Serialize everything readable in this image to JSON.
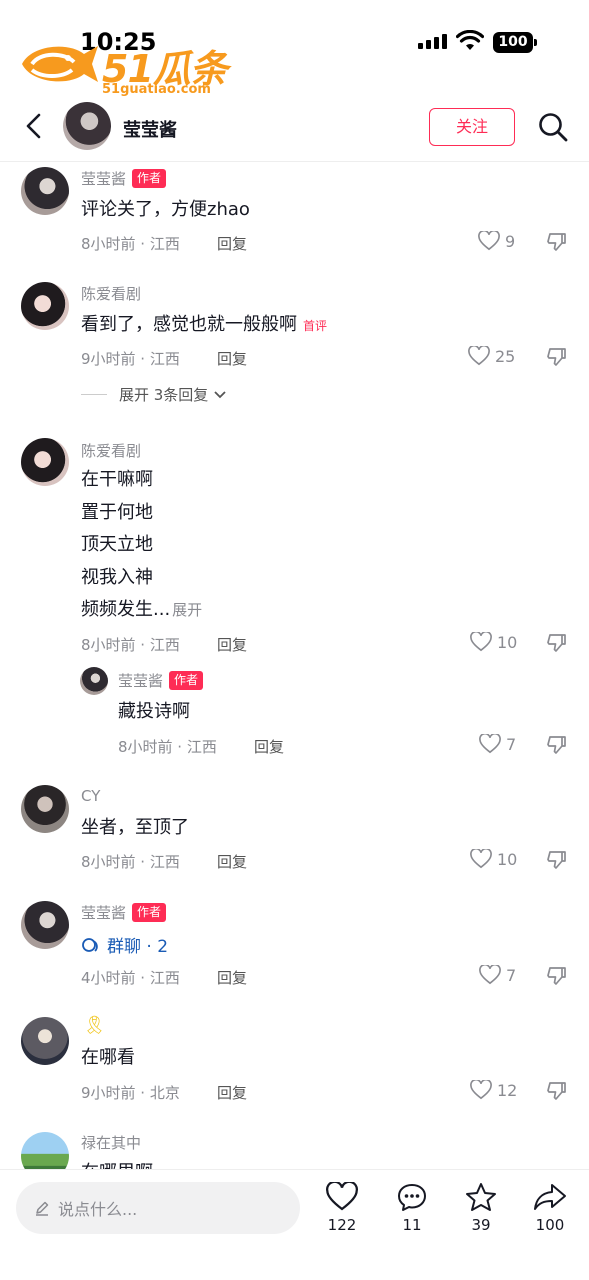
{
  "status": {
    "time": "10:25",
    "battery": "100"
  },
  "watermark": {
    "text": "51瓜条",
    "url": "51guatiao.com"
  },
  "header": {
    "name": "莹莹酱",
    "follow_label": "关注"
  },
  "comments": [
    {
      "user": "莹莹酱",
      "tag": "作者",
      "text": "评论关了，方便zhao",
      "meta": "8小时前 · 江西",
      "reply": "回复",
      "likes": "9"
    },
    {
      "user": "陈爱看剧",
      "text": "看到了，感觉也就一般般啊",
      "badge": "首评",
      "meta": "9小时前 · 江西",
      "reply": "回复",
      "likes": "25",
      "expand": "展开 3条回复"
    },
    {
      "user": "陈爱看剧",
      "lines": [
        "在干嘛啊",
        "置于何地",
        "顶天立地",
        "视我入神",
        "频频发生..."
      ],
      "more": "展开",
      "meta": "8小时前 · 江西",
      "reply": "回复",
      "likes": "10"
    },
    {
      "user": "莹莹酱",
      "tag": "作者",
      "text": "藏投诗啊",
      "meta": "8小时前 · 江西",
      "reply": "回复",
      "likes": "7"
    },
    {
      "user": "CY",
      "text": "坐者，至顶了",
      "meta": "8小时前 · 江西",
      "reply": "回复",
      "likes": "10"
    },
    {
      "user": "莹莹酱",
      "tag": "作者",
      "group": "群聊 · 2",
      "meta": "4小时前 · 江西",
      "reply": "回复",
      "likes": "7"
    },
    {
      "user": "🎗",
      "text": "在哪看",
      "meta": "9小时前 · 北京",
      "reply": "回复",
      "likes": "12"
    },
    {
      "user": "禄在其中",
      "text": "在哪里啊"
    }
  ],
  "bottom": {
    "placeholder": "说点什么...",
    "likes": "122",
    "comments": "11",
    "stars": "39",
    "shares": "100"
  }
}
